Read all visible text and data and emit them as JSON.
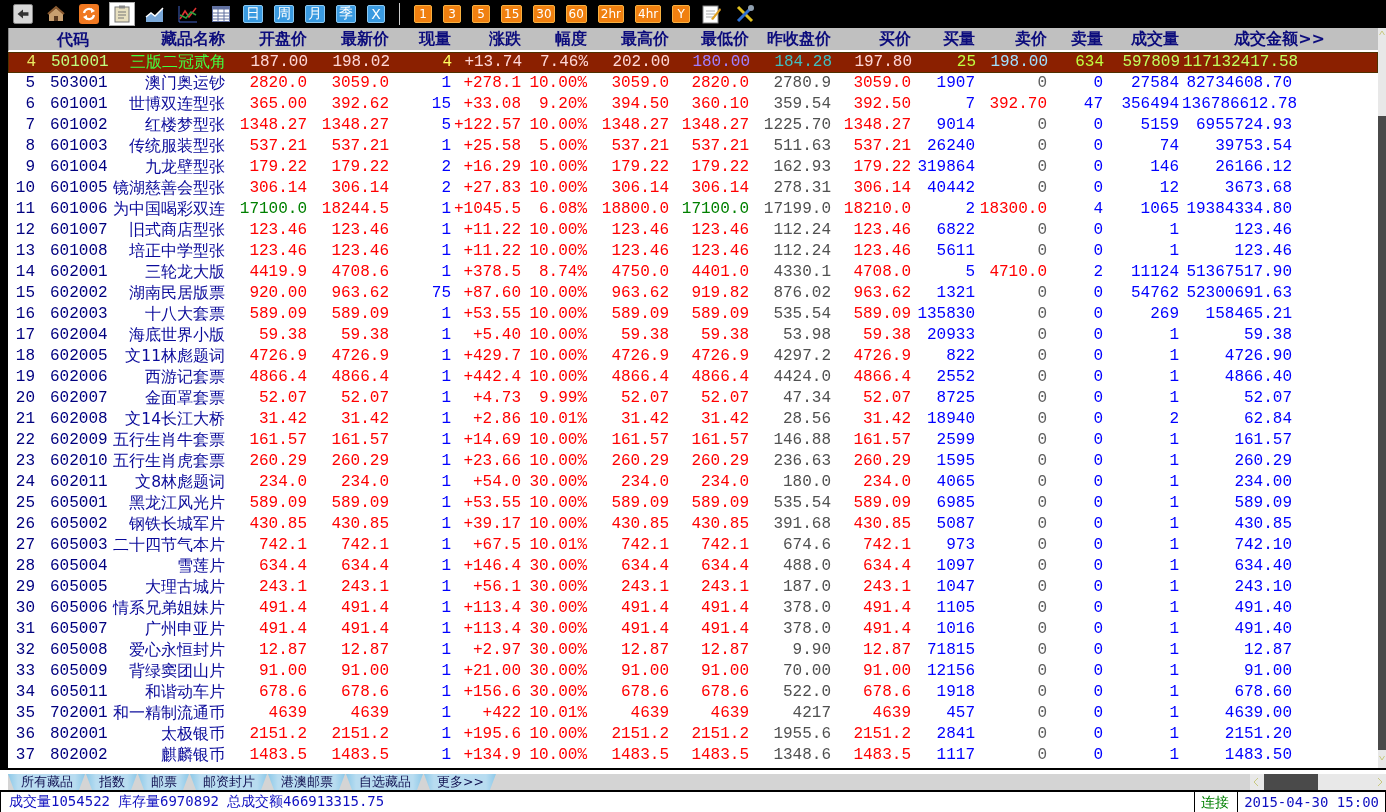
{
  "toolbar": [
    {
      "kind": "back",
      "selected": false
    },
    {
      "kind": "house",
      "selected": false
    },
    {
      "kind": "refresh",
      "selected": false
    },
    {
      "kind": "clipboard",
      "selected": true
    },
    {
      "kind": "chart",
      "selected": false
    },
    {
      "kind": "chart2",
      "selected": false
    },
    {
      "kind": "table",
      "selected": false
    },
    {
      "kind": "blue",
      "label": "日",
      "selected": false
    },
    {
      "kind": "blue",
      "label": "周",
      "selected": false
    },
    {
      "kind": "blue",
      "label": "月",
      "selected": false
    },
    {
      "kind": "blue",
      "label": "季",
      "selected": false
    },
    {
      "kind": "blue",
      "label": "X",
      "selected": false
    },
    {
      "kind": "separator"
    },
    {
      "kind": "orange",
      "label": "1",
      "selected": false
    },
    {
      "kind": "orange",
      "label": "3",
      "selected": false
    },
    {
      "kind": "orange",
      "label": "5",
      "selected": false
    },
    {
      "kind": "orange",
      "label": "15",
      "selected": false
    },
    {
      "kind": "orange",
      "label": "30",
      "selected": false
    },
    {
      "kind": "orange",
      "label": "60",
      "selected": false
    },
    {
      "kind": "orange",
      "label": "2hr",
      "selected": false
    },
    {
      "kind": "orange",
      "label": "4hr",
      "selected": false
    },
    {
      "kind": "orange",
      "label": "Y",
      "selected": false
    },
    {
      "kind": "note",
      "selected": false
    },
    {
      "kind": "tools",
      "selected": false
    }
  ],
  "table": {
    "columns": [
      "",
      "代码",
      "藏品名称",
      "开盘价",
      "最新价",
      "现量",
      "涨跌",
      "幅度",
      "最高价",
      "最低价",
      "昨收盘价",
      "买价",
      "买量",
      "卖价",
      "卖量",
      "成交量",
      "成交金额>>"
    ],
    "rows": [
      {
        "selected": true,
        "cells": [
          "4",
          "501001",
          "三版二冠贰角",
          "187.00",
          "198.02",
          "4",
          "+13.74",
          "7.46%",
          "202.00",
          "180.00",
          "184.28",
          "197.80",
          "25",
          "198.00",
          "634",
          "597809",
          "117132417.58"
        ]
      },
      {
        "selected": false,
        "cells": [
          "5",
          "503001",
          "澳门奥运钞",
          "2820.0",
          "3059.0",
          "1",
          "+278.1",
          "10.00%",
          "3059.0",
          "2820.0",
          "2780.9",
          "3059.0",
          "1907",
          "0",
          "0",
          "27584",
          "82734608.70"
        ]
      },
      {
        "selected": false,
        "cells": [
          "6",
          "601001",
          "世博双连型张",
          "365.00",
          "392.62",
          "15",
          "+33.08",
          "9.20%",
          "394.50",
          "360.10",
          "359.54",
          "392.50",
          "7",
          "392.70",
          "47",
          "356494",
          "136786612.78"
        ]
      },
      {
        "selected": false,
        "cells": [
          "7",
          "601002",
          "红楼梦型张",
          "1348.27",
          "1348.27",
          "5",
          "+122.57",
          "10.00%",
          "1348.27",
          "1348.27",
          "1225.70",
          "1348.27",
          "9014",
          "0",
          "0",
          "5159",
          "6955724.93"
        ]
      },
      {
        "selected": false,
        "cells": [
          "8",
          "601003",
          "传统服装型张",
          "537.21",
          "537.21",
          "1",
          "+25.58",
          "5.00%",
          "537.21",
          "537.21",
          "511.63",
          "537.21",
          "26240",
          "0",
          "0",
          "74",
          "39753.54"
        ]
      },
      {
        "selected": false,
        "cells": [
          "9",
          "601004",
          "九龙壁型张",
          "179.22",
          "179.22",
          "2",
          "+16.29",
          "10.00%",
          "179.22",
          "179.22",
          "162.93",
          "179.22",
          "319864",
          "0",
          "0",
          "146",
          "26166.12"
        ]
      },
      {
        "selected": false,
        "cells": [
          "10",
          "601005",
          "镜湖慈善会型张",
          "306.14",
          "306.14",
          "2",
          "+27.83",
          "10.00%",
          "306.14",
          "306.14",
          "278.31",
          "306.14",
          "40442",
          "0",
          "0",
          "12",
          "3673.68"
        ]
      },
      {
        "selected": false,
        "cells": [
          "11",
          "601006",
          "为中国喝彩双连",
          "17100.0",
          "18244.5",
          "1",
          "+1045.5",
          "6.08%",
          "18800.0",
          "17100.0",
          "17199.0",
          "18210.0",
          "2",
          "18300.0",
          "4",
          "1065",
          "19384334.80"
        ]
      },
      {
        "selected": false,
        "cells": [
          "12",
          "601007",
          "旧式商店型张",
          "123.46",
          "123.46",
          "1",
          "+11.22",
          "10.00%",
          "123.46",
          "123.46",
          "112.24",
          "123.46",
          "6822",
          "0",
          "0",
          "1",
          "123.46"
        ]
      },
      {
        "selected": false,
        "cells": [
          "13",
          "601008",
          "培正中学型张",
          "123.46",
          "123.46",
          "1",
          "+11.22",
          "10.00%",
          "123.46",
          "123.46",
          "112.24",
          "123.46",
          "5611",
          "0",
          "0",
          "1",
          "123.46"
        ]
      },
      {
        "selected": false,
        "cells": [
          "14",
          "602001",
          "三轮龙大版",
          "4419.9",
          "4708.6",
          "1",
          "+378.5",
          "8.74%",
          "4750.0",
          "4401.0",
          "4330.1",
          "4708.0",
          "5",
          "4710.0",
          "2",
          "11124",
          "51367517.90"
        ]
      },
      {
        "selected": false,
        "cells": [
          "15",
          "602002",
          "湖南民居版票",
          "920.00",
          "963.62",
          "75",
          "+87.60",
          "10.00%",
          "963.62",
          "919.82",
          "876.02",
          "963.62",
          "1321",
          "0",
          "0",
          "54762",
          "52300691.63"
        ]
      },
      {
        "selected": false,
        "cells": [
          "16",
          "602003",
          "十八大套票",
          "589.09",
          "589.09",
          "1",
          "+53.55",
          "10.00%",
          "589.09",
          "589.09",
          "535.54",
          "589.09",
          "135830",
          "0",
          "0",
          "269",
          "158465.21"
        ]
      },
      {
        "selected": false,
        "cells": [
          "17",
          "602004",
          "海底世界小版",
          "59.38",
          "59.38",
          "1",
          "+5.40",
          "10.00%",
          "59.38",
          "59.38",
          "53.98",
          "59.38",
          "20933",
          "0",
          "0",
          "1",
          "59.38"
        ]
      },
      {
        "selected": false,
        "cells": [
          "18",
          "602005",
          "文11林彪题词",
          "4726.9",
          "4726.9",
          "1",
          "+429.7",
          "10.00%",
          "4726.9",
          "4726.9",
          "4297.2",
          "4726.9",
          "822",
          "0",
          "0",
          "1",
          "4726.90"
        ]
      },
      {
        "selected": false,
        "cells": [
          "19",
          "602006",
          "西游记套票",
          "4866.4",
          "4866.4",
          "1",
          "+442.4",
          "10.00%",
          "4866.4",
          "4866.4",
          "4424.0",
          "4866.4",
          "2552",
          "0",
          "0",
          "1",
          "4866.40"
        ]
      },
      {
        "selected": false,
        "cells": [
          "20",
          "602007",
          "金面罩套票",
          "52.07",
          "52.07",
          "1",
          "+4.73",
          "9.99%",
          "52.07",
          "52.07",
          "47.34",
          "52.07",
          "8725",
          "0",
          "0",
          "1",
          "52.07"
        ]
      },
      {
        "selected": false,
        "cells": [
          "21",
          "602008",
          "文14长江大桥",
          "31.42",
          "31.42",
          "1",
          "+2.86",
          "10.01%",
          "31.42",
          "31.42",
          "28.56",
          "31.42",
          "18940",
          "0",
          "0",
          "2",
          "62.84"
        ]
      },
      {
        "selected": false,
        "cells": [
          "22",
          "602009",
          "五行生肖牛套票",
          "161.57",
          "161.57",
          "1",
          "+14.69",
          "10.00%",
          "161.57",
          "161.57",
          "146.88",
          "161.57",
          "2599",
          "0",
          "0",
          "1",
          "161.57"
        ]
      },
      {
        "selected": false,
        "cells": [
          "23",
          "602010",
          "五行生肖虎套票",
          "260.29",
          "260.29",
          "1",
          "+23.66",
          "10.00%",
          "260.29",
          "260.29",
          "236.63",
          "260.29",
          "1595",
          "0",
          "0",
          "1",
          "260.29"
        ]
      },
      {
        "selected": false,
        "cells": [
          "24",
          "602011",
          "文8林彪题词",
          "234.0",
          "234.0",
          "1",
          "+54.0",
          "30.00%",
          "234.0",
          "234.0",
          "180.0",
          "234.0",
          "4065",
          "0",
          "0",
          "1",
          "234.00"
        ]
      },
      {
        "selected": false,
        "cells": [
          "25",
          "605001",
          "黑龙江风光片",
          "589.09",
          "589.09",
          "1",
          "+53.55",
          "10.00%",
          "589.09",
          "589.09",
          "535.54",
          "589.09",
          "6985",
          "0",
          "0",
          "1",
          "589.09"
        ]
      },
      {
        "selected": false,
        "cells": [
          "26",
          "605002",
          "钢铁长城军片",
          "430.85",
          "430.85",
          "1",
          "+39.17",
          "10.00%",
          "430.85",
          "430.85",
          "391.68",
          "430.85",
          "5087",
          "0",
          "0",
          "1",
          "430.85"
        ]
      },
      {
        "selected": false,
        "cells": [
          "27",
          "605003",
          "二十四节气本片",
          "742.1",
          "742.1",
          "1",
          "+67.5",
          "10.01%",
          "742.1",
          "742.1",
          "674.6",
          "742.1",
          "973",
          "0",
          "0",
          "1",
          "742.10"
        ]
      },
      {
        "selected": false,
        "cells": [
          "28",
          "605004",
          "雪莲片",
          "634.4",
          "634.4",
          "1",
          "+146.4",
          "30.00%",
          "634.4",
          "634.4",
          "488.0",
          "634.4",
          "1097",
          "0",
          "0",
          "1",
          "634.40"
        ]
      },
      {
        "selected": false,
        "cells": [
          "29",
          "605005",
          "大理古城片",
          "243.1",
          "243.1",
          "1",
          "+56.1",
          "30.00%",
          "243.1",
          "243.1",
          "187.0",
          "243.1",
          "1047",
          "0",
          "0",
          "1",
          "243.10"
        ]
      },
      {
        "selected": false,
        "cells": [
          "30",
          "605006",
          "情系兄弟姐妹片",
          "491.4",
          "491.4",
          "1",
          "+113.4",
          "30.00%",
          "491.4",
          "491.4",
          "378.0",
          "491.4",
          "1105",
          "0",
          "0",
          "1",
          "491.40"
        ]
      },
      {
        "selected": false,
        "cells": [
          "31",
          "605007",
          "广州申亚片",
          "491.4",
          "491.4",
          "1",
          "+113.4",
          "30.00%",
          "491.4",
          "491.4",
          "378.0",
          "491.4",
          "1016",
          "0",
          "0",
          "1",
          "491.40"
        ]
      },
      {
        "selected": false,
        "cells": [
          "32",
          "605008",
          "爱心永恒封片",
          "12.87",
          "12.87",
          "1",
          "+2.97",
          "30.00%",
          "12.87",
          "12.87",
          "9.90",
          "12.87",
          "71815",
          "0",
          "0",
          "1",
          "12.87"
        ]
      },
      {
        "selected": false,
        "cells": [
          "33",
          "605009",
          "背绿窦团山片",
          "91.00",
          "91.00",
          "1",
          "+21.00",
          "30.00%",
          "91.00",
          "91.00",
          "70.00",
          "91.00",
          "12156",
          "0",
          "0",
          "1",
          "91.00"
        ]
      },
      {
        "selected": false,
        "cells": [
          "34",
          "605011",
          "和谐动车片",
          "678.6",
          "678.6",
          "1",
          "+156.6",
          "30.00%",
          "678.6",
          "678.6",
          "522.0",
          "678.6",
          "1918",
          "0",
          "0",
          "1",
          "678.60"
        ]
      },
      {
        "selected": false,
        "cells": [
          "35",
          "702001",
          "和一精制流通币",
          "4639",
          "4639",
          "1",
          "+422",
          "10.01%",
          "4639",
          "4639",
          "4217",
          "4639",
          "457",
          "0",
          "0",
          "1",
          "4639.00"
        ]
      },
      {
        "selected": false,
        "cells": [
          "36",
          "802001",
          "太极银币",
          "2151.2",
          "2151.2",
          "1",
          "+195.6",
          "10.00%",
          "2151.2",
          "2151.2",
          "1955.6",
          "2151.2",
          "2841",
          "0",
          "0",
          "1",
          "2151.20"
        ]
      },
      {
        "selected": false,
        "cells": [
          "37",
          "802002",
          "麒麟银币",
          "1483.5",
          "1483.5",
          "1",
          "+134.9",
          "10.00%",
          "1483.5",
          "1483.5",
          "1348.6",
          "1483.5",
          "1117",
          "0",
          "0",
          "1",
          "1483.50"
        ]
      }
    ]
  },
  "category_tabs": [
    "所有藏品",
    "指数",
    "邮票",
    "邮资封片",
    "港澳邮票",
    "自选藏品",
    "更多>>"
  ],
  "status_bar": {
    "totals": [
      "成交量1054522",
      "库存量6970892",
      "总成交额466913315.75"
    ],
    "connection": "连接",
    "datetime": "2015-04-30 15:00"
  }
}
